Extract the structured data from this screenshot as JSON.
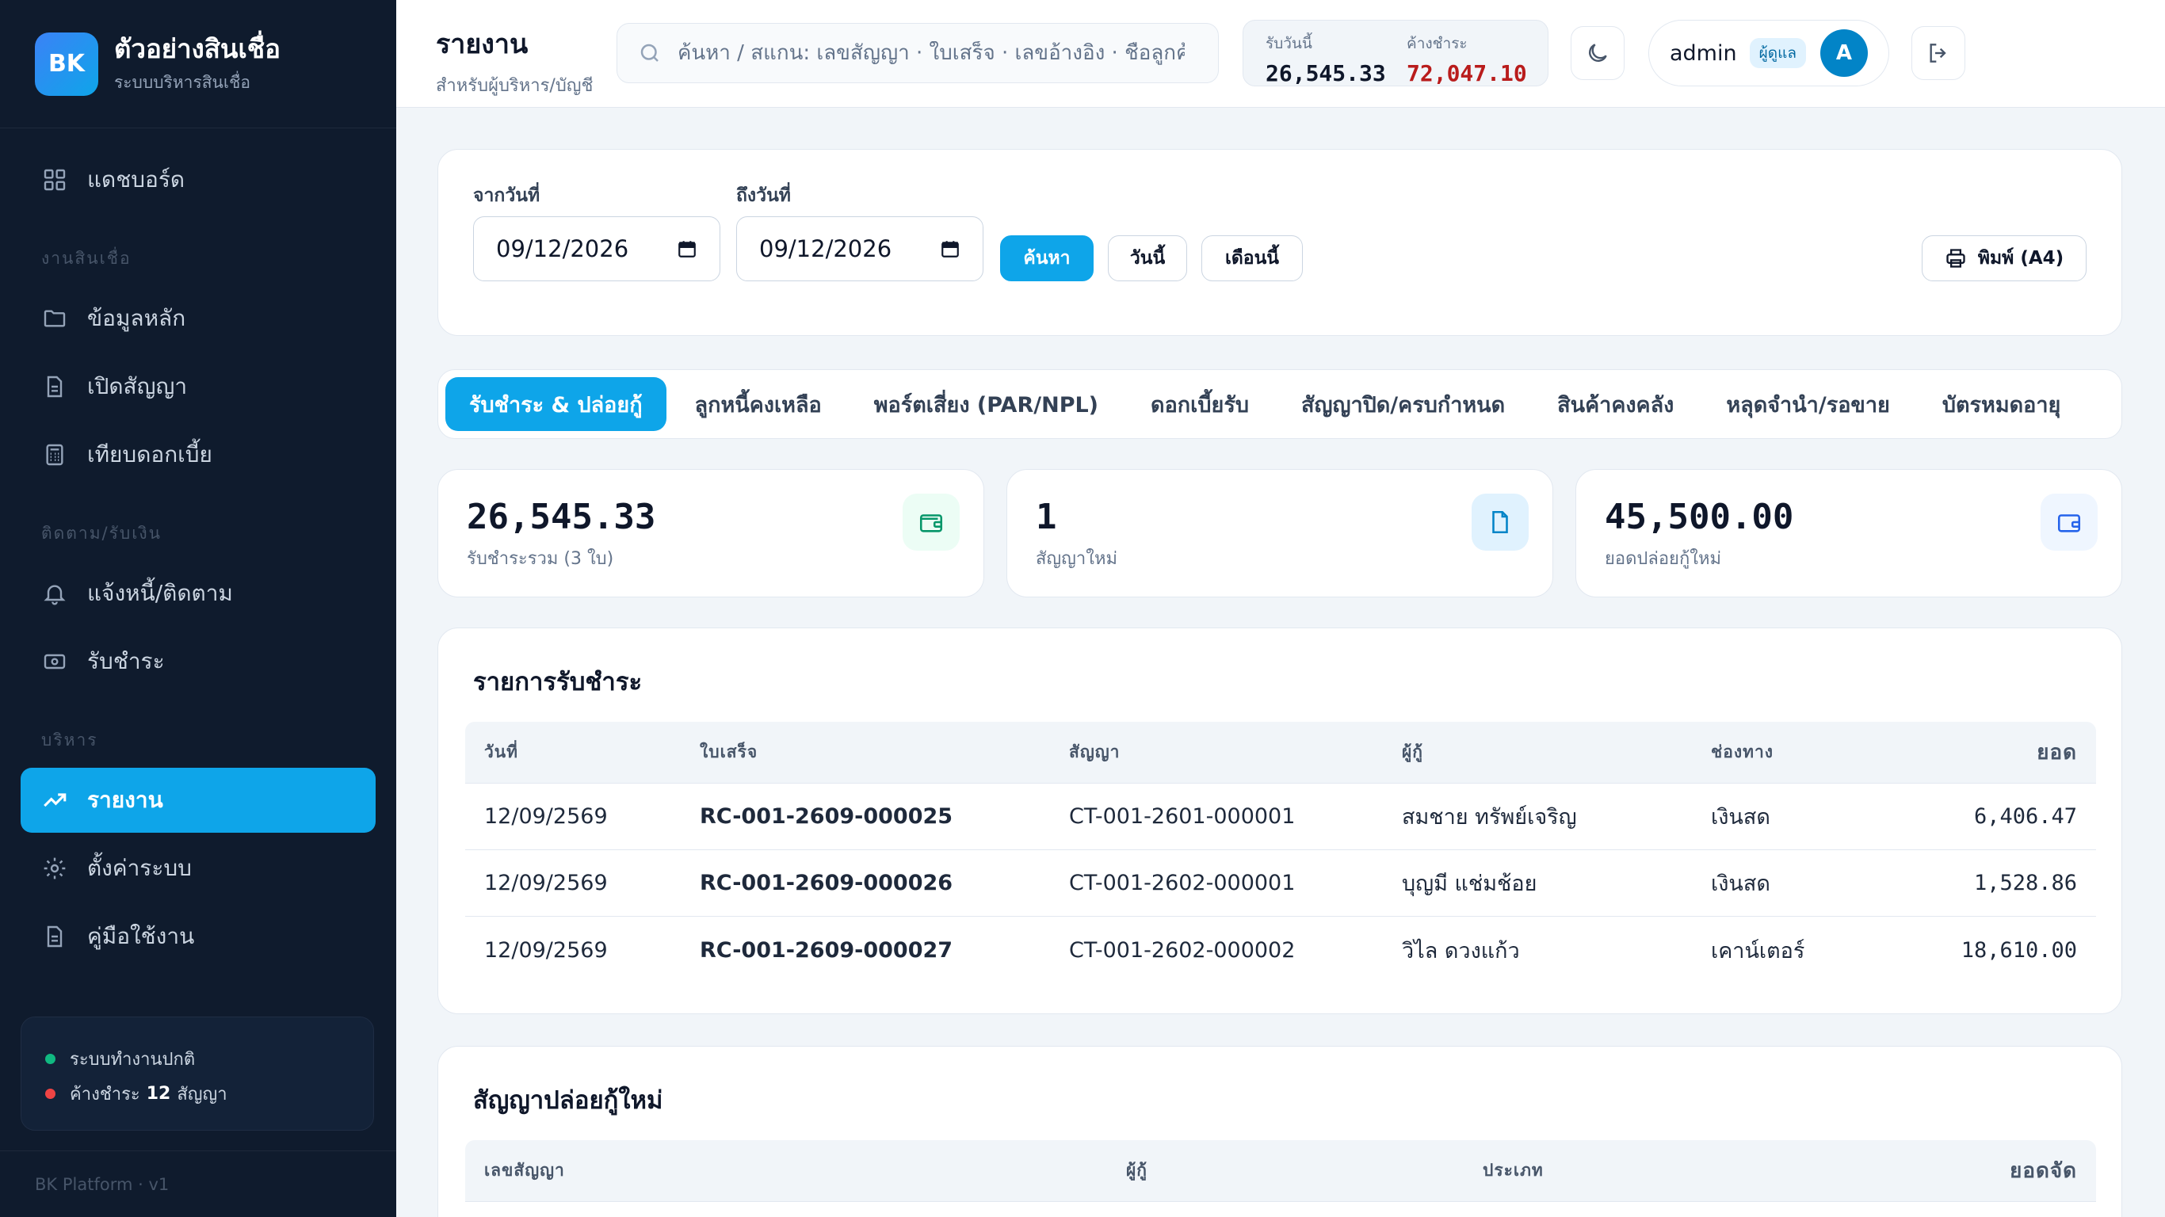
{
  "brand": {
    "logo": "BK",
    "title": "ตัวอย่างสินเชื่อ",
    "subtitle": "ระบบบริหารสินเชื่อ"
  },
  "sidebar": {
    "dashboard": "แดชบอร์ด",
    "section_loans": "งานสินเชื่อ",
    "master_data": "ข้อมูลหลัก",
    "open_contract": "เปิดสัญญา",
    "compare_interest": "เทียบดอกเบี้ย",
    "section_collect": "ติดตาม/รับเงิน",
    "notify": "แจ้งหนี้/ติดตาม",
    "receive": "รับชำระ",
    "section_admin": "บริหาร",
    "reports": "รายงาน",
    "settings": "ตั้งค่าระบบ",
    "manual": "คู่มือใช้งาน",
    "status_ok": "ระบบทำงานปกติ",
    "overdue_prefix": "ค้างชำระ",
    "overdue_count": "12",
    "overdue_suffix": "สัญญา",
    "footer": "BK Platform · v1"
  },
  "header": {
    "title": "รายงาน",
    "subtitle": "สำหรับผู้บริหาร/บัญชี",
    "search_placeholder": "ค้นหา / สแกน: เลขสัญญา · ใบเสร็จ · เลขอ้างอิง · ชื่อลูกค้า",
    "today_label": "รับวันนี้",
    "today_value": "26,545.33",
    "overdue_label": "ค้างชำระ",
    "overdue_value": "72,047.10",
    "user": "admin",
    "role": "ผู้ดูแล",
    "avatar": "A"
  },
  "filter": {
    "from_label": "จากวันที่",
    "from_value": "09/12/2026",
    "to_label": "ถึงวันที่",
    "to_value": "09/12/2026",
    "search_btn": "ค้นหา",
    "today_btn": "วันนี้",
    "month_btn": "เดือนนี้",
    "print_btn": "พิมพ์ (A4)"
  },
  "tabs": [
    "รับชำระ & ปล่อยกู้",
    "ลูกหนี้คงเหลือ",
    "พอร์ตเสี่ยง (PAR/NPL)",
    "ดอกเบี้ยรับ",
    "สัญญาปิด/ครบกำหนด",
    "สินค้าคงคลัง",
    "หลุดจำนำ/รอขาย",
    "บัตรหมดอายุ"
  ],
  "stats": [
    {
      "value": "26,545.33",
      "label": "รับชำระรวม (3 ใบ)"
    },
    {
      "value": "1",
      "label": "สัญญาใหม่"
    },
    {
      "value": "45,500.00",
      "label": "ยอดปล่อยกู้ใหม่"
    }
  ],
  "payments": {
    "title": "รายการรับชำระ",
    "headers": [
      "วันที่",
      "ใบเสร็จ",
      "สัญญา",
      "ผู้กู้",
      "ช่องทาง",
      "ยอด"
    ],
    "rows": [
      [
        "12/09/2569",
        "RC-001-2609-000025",
        "CT-001-2601-000001",
        "สมชาย ทรัพย์เจริญ",
        "เงินสด",
        "6,406.47"
      ],
      [
        "12/09/2569",
        "RC-001-2609-000026",
        "CT-001-2602-000001",
        "บุญมี แช่มช้อย",
        "เงินสด",
        "1,528.86"
      ],
      [
        "12/09/2569",
        "RC-001-2609-000027",
        "CT-001-2602-000002",
        "วิไล ดวงแก้ว",
        "เคาน์เตอร์",
        "18,610.00"
      ]
    ]
  },
  "new_loans": {
    "title": "สัญญาปล่อยกู้ใหม่",
    "headers": [
      "เลขสัญญา",
      "ผู้กู้",
      "ประเภท",
      "ยอดจัด"
    ]
  },
  "colors": {
    "accent": "#0ea5e9",
    "sidebar_bg": "#0f1b2d",
    "danger": "#b91c1c",
    "success": "#10b981"
  }
}
